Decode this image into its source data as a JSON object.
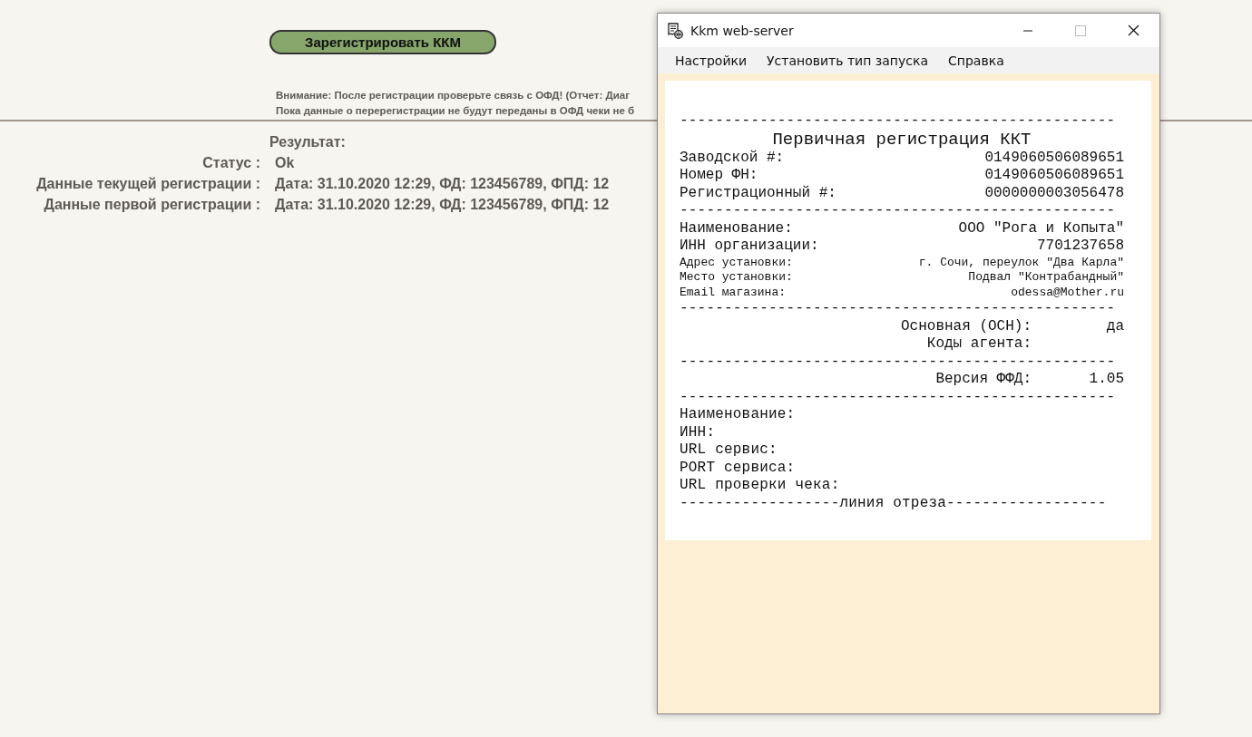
{
  "page": {
    "register_button": "Зарегистрировать ККМ",
    "notice": [
      "Внимание: После регистрации проверьте связь с ОФД! (Отчет: Диаг",
      "Пока данные о перерегистрации не будут переданы в ОФД чеки не б"
    ],
    "result_heading": "Результат:",
    "results": [
      {
        "label": "Статус :",
        "value": "Ok"
      },
      {
        "label": "Данные текущей регистрации :",
        "value": "Дата: 31.10.2020 12:29, ФД: 123456789, ФПД: 12"
      },
      {
        "label": "Данные первой регистрации :",
        "value": "Дата: 31.10.2020 12:29, ФД: 123456789, ФПД: 12"
      }
    ]
  },
  "window": {
    "title": "Kkm web-server",
    "menu": [
      "Настройки",
      "Установить тип запуска",
      "Справка"
    ],
    "receipt": [
      {
        "kind": "rule",
        "text": "-------------------------------------------------"
      },
      {
        "kind": "title",
        "text": "Первичная регистрация ККТ"
      },
      {
        "kind": "pair",
        "label": "Заводской #:",
        "value": "0149060506089651"
      },
      {
        "kind": "pair",
        "label": "Номер ФН:",
        "value": "0149060506089651"
      },
      {
        "kind": "pair",
        "label": "Регистрационный #:",
        "value": "0000000003056478"
      },
      {
        "kind": "rule",
        "text": "-------------------------------------------------"
      },
      {
        "kind": "pair",
        "label": "Наименование:",
        "value": "ООО \"Рога и Копыта\""
      },
      {
        "kind": "pair",
        "label": "ИНН организации:",
        "value": "7701237658"
      },
      {
        "kind": "small",
        "label": "Адрес установки:",
        "value": "г. Сочи, переулок \"Два Карла\""
      },
      {
        "kind": "small",
        "label": "Место установки:",
        "value": "Подвал \"Контрабандный\""
      },
      {
        "kind": "small",
        "label": "Email магазина:",
        "value": "odessa@Mother.ru"
      },
      {
        "kind": "rule",
        "text": "-------------------------------------------------"
      },
      {
        "kind": "right",
        "label": "Основная (ОСН):",
        "value": "да"
      },
      {
        "kind": "right",
        "label": "Коды агента:"
      },
      {
        "kind": "rule",
        "text": "-------------------------------------------------"
      },
      {
        "kind": "right",
        "label": "Версия ФФД:",
        "value": "1.05"
      },
      {
        "kind": "rule",
        "text": "-------------------------------------------------"
      },
      {
        "kind": "line",
        "text": "Наименование:"
      },
      {
        "kind": "line",
        "text": "ИНН:"
      },
      {
        "kind": "line",
        "text": "URL сервис:"
      },
      {
        "kind": "line",
        "text": "PORT сервиса:"
      },
      {
        "kind": "line",
        "text": "URL проверки чека:"
      },
      {
        "kind": "rule",
        "text": "------------------линия отреза------------------"
      }
    ]
  }
}
